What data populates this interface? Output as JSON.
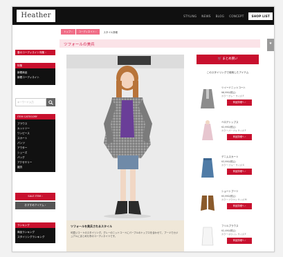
{
  "header": {
    "logo": "Heather",
    "nav": [
      "STYLING",
      "NEWS",
      "BLOG",
      "CONCEPT",
      "SHOP LIST"
    ]
  },
  "sidebar": {
    "feature_banner": "春のコーディネイト特集 ›",
    "menu_box_title": "特集",
    "menu_items": [
      "新着商品",
      "新着コーディネイト"
    ],
    "search_placeholder": "キーワード入力",
    "category_title": "ITEM CATEGORY",
    "categories": [
      "ブラウス",
      "カットソー",
      "ワンピース",
      "スカート",
      "パンツ",
      "アウター",
      "シューズ",
      "バッグ",
      "アクセサリー",
      "雑貨"
    ],
    "sale_banner": "SALE ITEM ›",
    "recommended_banner": "おすすめアイテム ›",
    "ranking_title": "ランキング",
    "ranking_items": [
      "商品ランキング",
      "スタイリングランキング"
    ]
  },
  "breadcrumb": {
    "items": [
      "トップ ›",
      "コーディネイト ›"
    ],
    "current": "スタイル詳細"
  },
  "main": {
    "section_title": "ツフォールの美兵",
    "side_tag": "★",
    "caption_title": "ツフォールを美兵されるスタイル",
    "caption_text": "可愛いコートのスタイリング。グレーのニットコートにパープルのトップスを合わせて、ブーツでカジュアルにまとめた冬のコーディネイトです。"
  },
  "right": {
    "buy_button": "🛒 まとめ買い",
    "coord_title": "このスタイリングで使用したアイテム",
    "items": [
      {
        "name": "ツイードニットコート",
        "price": "¥6,990(税込)",
        "detail": "カラー:グレー サイズ:F",
        "button": "商品詳細へ ›"
      },
      {
        "name": "ベロアトップス",
        "price": "¥2,990(税込)",
        "detail": "カラー:パープル サイズ:F",
        "button": "商品詳細へ ›"
      },
      {
        "name": "デニムスカート",
        "price": "¥3,990(税込)",
        "detail": "カラー:ブルー サイズ:S",
        "button": "商品詳細へ ›"
      },
      {
        "name": "ショートブーツ",
        "price": "¥5,990(税込)",
        "detail": "カラー:ブラウン サイズ:M",
        "button": "商品詳細へ ›"
      },
      {
        "name": "フリルブラウス",
        "price": "¥2,490(税込)",
        "detail": "カラー:ホワイト サイズ:F",
        "button": "商品詳細へ ›"
      }
    ]
  },
  "colors": {
    "accent_red": "#c8102e",
    "pink": "#f06d87",
    "pink_band": "#fbe3e8",
    "header_bg": "#101010"
  }
}
